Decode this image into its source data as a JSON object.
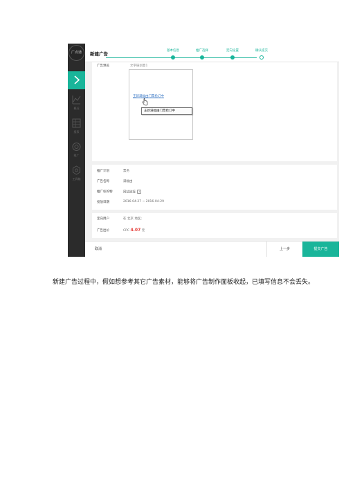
{
  "screenshot": {
    "sidebar": {
      "logo": "广点通",
      "items": [
        {
          "label": "概况",
          "icon": "chart-line-icon"
        },
        {
          "label": "报表",
          "icon": "table-icon"
        },
        {
          "label": "推广",
          "icon": "target-icon"
        },
        {
          "label": "工具箱",
          "icon": "gear-icon"
        }
      ],
      "active_icon": "chevron-right-icon"
    },
    "header": {
      "title": "新建广告",
      "steps": [
        "基本信息",
        "推广选择",
        "定向设置",
        "确认提交"
      ]
    },
    "preview": {
      "label": "广告预览",
      "creative_name": "文字链创意1",
      "link_text": "王新满福由门票抢订中",
      "tooltip": "王新满福由门票抢订中"
    },
    "info": {
      "plan_label": "推广计划",
      "plan_value": "票务",
      "name_label": "广告名称",
      "name_value": "满福由",
      "target_label": "推广标的物",
      "target_value": "网站链接",
      "date_label": "投放日期",
      "date_value": "2016-04-27 ~ 2016-04-29"
    },
    "targeting": {
      "users_label": "定向用户",
      "users_value": "在 北京 地区;",
      "bid_label": "广告出价",
      "bid_prefix": "CPC",
      "bid_price": "4.07",
      "bid_unit": "元"
    },
    "footer": {
      "cancel": "取消",
      "prev": "上一步",
      "submit": "提交广告"
    }
  },
  "paragraph": "新建广告过程中，假如想参考其它广告素材，能够将广告制作面板收起，已填写信息不会丢失。",
  "colors": {
    "accent": "#19b59a",
    "sidebar": "#2b2b2b",
    "link": "#3a78c5",
    "price": "#e53935"
  }
}
